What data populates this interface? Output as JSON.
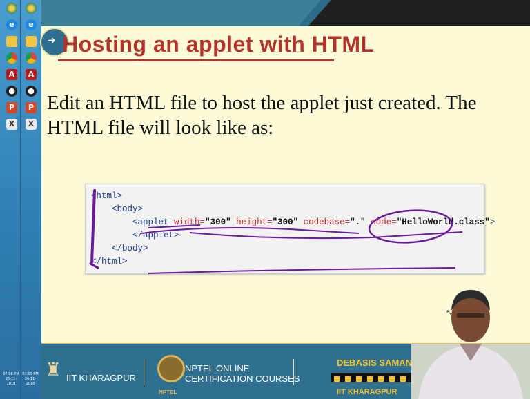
{
  "slide": {
    "title": "Hosting an applet with HTML",
    "body": "Edit an HTML file to host the applet just created. The HTML file will look like as:"
  },
  "code": {
    "line1": "<html>",
    "line2": "<body>",
    "line3_open": "<applet",
    "line3_attr1": "width=",
    "line3_val1": "\"300\"",
    "line3_attr2": "height=",
    "line3_val2": "\"300\"",
    "line3_attr3": "codebase=",
    "line3_val3": "\".\"",
    "line3_attr4": "code=",
    "line3_val4": "\"HelloWorld.class\"",
    "line3_close": ">",
    "line4": "</applet>",
    "line5": "</body>",
    "line6": "</html>"
  },
  "footer": {
    "org": "IIT KHARAGPUR",
    "nptel_line1": "NPTEL ONLINE",
    "nptel_line2": "CERTIFICATION COURSES",
    "nptel_small": "NPTEL",
    "presenter": "DEBASIS SAMANTA",
    "presenter_org": "IIT KHARAGPUR"
  },
  "taskbar": {
    "icons": [
      "program-icon",
      "ie-icon",
      "folder-icon",
      "chrome-icon",
      "pdf-icon",
      "media-icon",
      "powerpoint-icon",
      "excel-icon"
    ],
    "clock1_time": "07:06 PM",
    "clock1_date": "26-11-2018",
    "clock2_time": "07:05 PM",
    "clock2_date": "26-11-2018"
  },
  "colors": {
    "title": "#b3322a",
    "slide_bg": "#fdfbd8",
    "footer_bg": "#2f6f8f",
    "annotation": "#6a1b9a"
  }
}
